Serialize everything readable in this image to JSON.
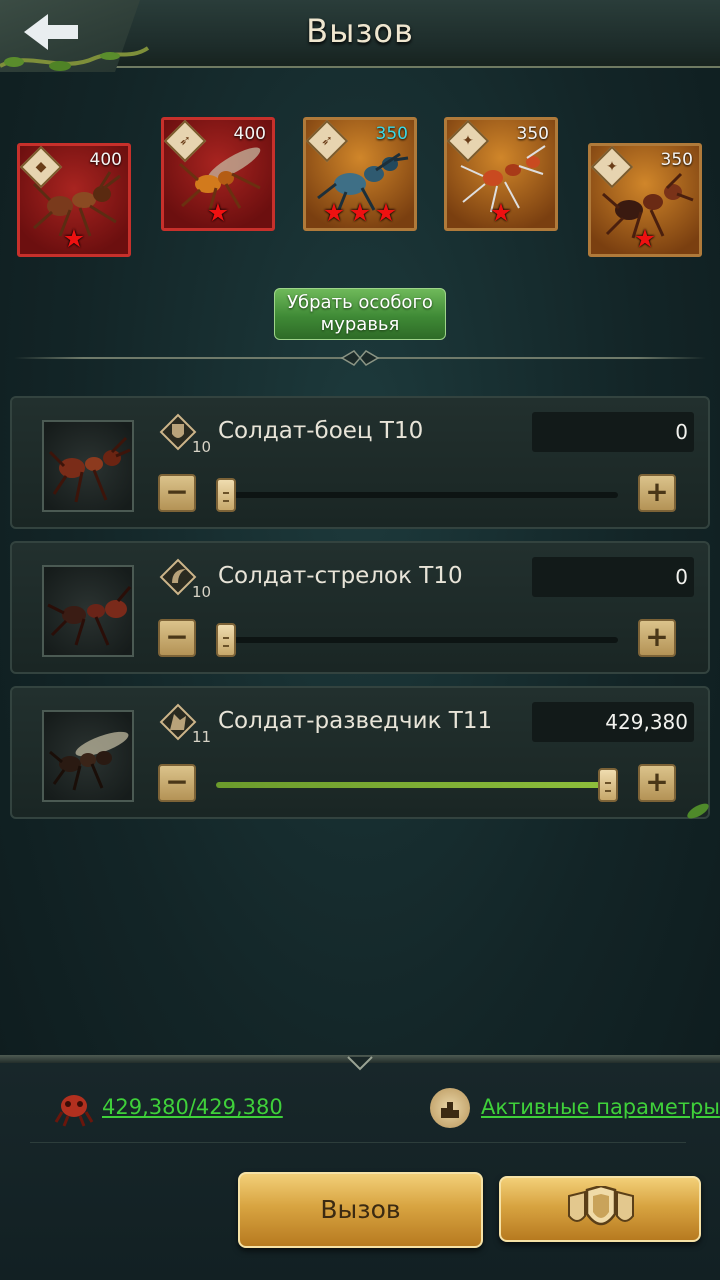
{
  "header": {
    "title": "Вызов"
  },
  "special_ants": [
    {
      "power": "400",
      "stars": 1,
      "frame": "red",
      "class_glyph": "◆"
    },
    {
      "power": "400",
      "stars": 1,
      "frame": "red",
      "class_glyph": "➶"
    },
    {
      "power": "350",
      "stars": 3,
      "frame": "gold",
      "class_glyph": "➶"
    },
    {
      "power": "350",
      "stars": 1,
      "frame": "gold",
      "class_glyph": "✦"
    },
    {
      "power": "350",
      "stars": 1,
      "frame": "gold",
      "class_glyph": "✦"
    }
  ],
  "remove_special_label": "Убрать особого муравья",
  "soldiers": [
    {
      "name": "Солдат-боец T10",
      "tier": "10",
      "quantity": "0",
      "slider_fraction": 0.0,
      "class_icon": "shield-icon"
    },
    {
      "name": "Солдат-стрелок T10",
      "tier": "10",
      "quantity": "0",
      "slider_fraction": 0.0,
      "class_icon": "bow-icon"
    },
    {
      "name": "Солдат-разведчик T11",
      "tier": "11",
      "quantity": "429,380",
      "slider_fraction": 1.0,
      "class_icon": "wing-icon"
    }
  ],
  "footer": {
    "capacity": "429,380/429,380",
    "params_label": "Активные параметры",
    "call_label": "Вызов"
  },
  "colors": {
    "accent_green": "#3fd03a",
    "gold": "#d8a441"
  }
}
